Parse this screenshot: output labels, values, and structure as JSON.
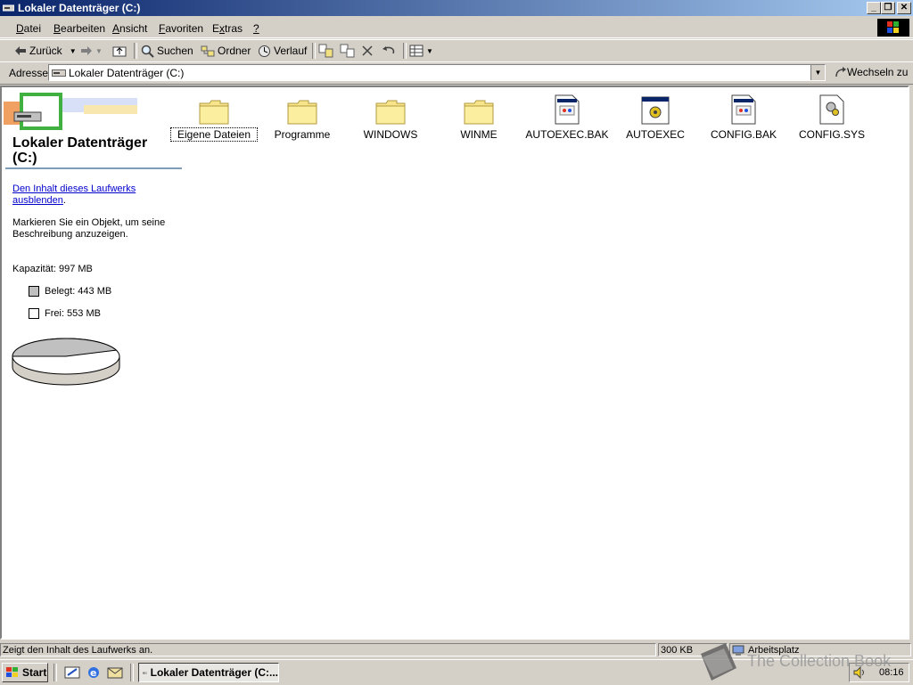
{
  "window": {
    "title": "Lokaler Datenträger (C:)"
  },
  "menu": [
    {
      "pre": "",
      "u": "D",
      "post": "atei"
    },
    {
      "pre": "",
      "u": "B",
      "post": "earbeiten"
    },
    {
      "pre": "",
      "u": "A",
      "post": "nsicht"
    },
    {
      "pre": "",
      "u": "F",
      "post": "avoriten"
    },
    {
      "pre": "E",
      "u": "x",
      "post": "tras"
    },
    {
      "pre": "",
      "u": "?",
      "post": ""
    }
  ],
  "toolbar": {
    "back": "Zurück",
    "search": "Suchen",
    "folders": "Ordner",
    "history": "Verlauf"
  },
  "address": {
    "label": "Adresse",
    "value": "Lokaler Datenträger (C:)",
    "go": "Wechseln zu"
  },
  "left": {
    "title": "Lokaler Datenträger (C:)",
    "link": "Den Inhalt dieses Laufwerks ausblenden",
    "link_suffix": ".",
    "description": "Markieren Sie ein Objekt, um seine Beschreibung anzuzeigen.",
    "capacity": "Kapazität: 997 MB",
    "used": "Belegt: 443 MB",
    "free": "Frei: 553 MB",
    "used_fraction": 0.444,
    "colors": {
      "used": "#c0c0c0",
      "free": "#ffffff"
    }
  },
  "files": [
    {
      "name": "Eigene Dateien",
      "icon": "folder-icon",
      "selected": true
    },
    {
      "name": "Programme",
      "icon": "folder-icon"
    },
    {
      "name": "WINDOWS",
      "icon": "folder-icon"
    },
    {
      "name": "WINME",
      "icon": "folder-icon"
    },
    {
      "name": "AUTOEXEC.BAK",
      "icon": "document-icon"
    },
    {
      "name": "AUTOEXEC",
      "icon": "batch-file-icon"
    },
    {
      "name": "CONFIG.BAK",
      "icon": "document-icon"
    },
    {
      "name": "CONFIG.SYS",
      "icon": "system-file-icon"
    }
  ],
  "status": {
    "text": "Zeigt den Inhalt des Laufwerks an.",
    "size": "300 KB",
    "zone": "Arbeitsplatz"
  },
  "taskbar": {
    "start": "Start",
    "task": "Lokaler Datenträger (C:...",
    "clock": "08:16"
  },
  "watermark": "The Collection Book"
}
